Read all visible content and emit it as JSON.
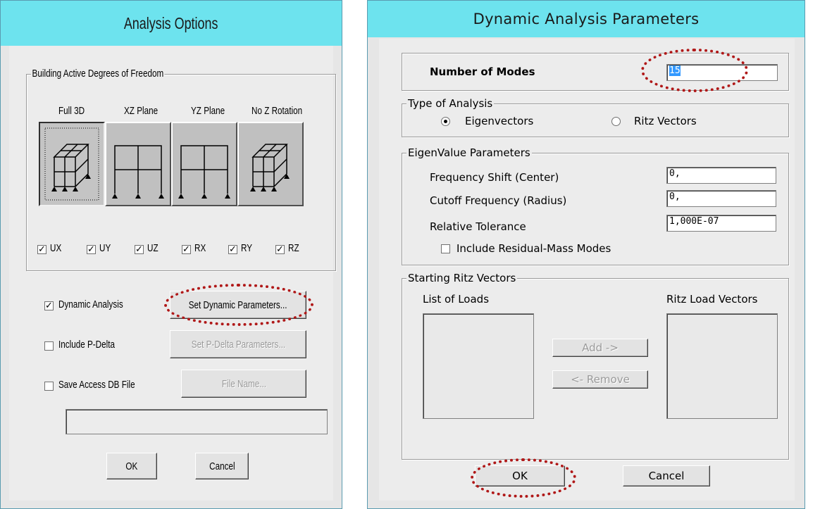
{
  "analysis_options": {
    "title": "Analysis Options",
    "dof_group_label": "Building Active Degrees of Freedom",
    "dof_options": [
      {
        "label": "Full 3D",
        "selected": true
      },
      {
        "label": "XZ Plane",
        "selected": false
      },
      {
        "label": "YZ Plane",
        "selected": false
      },
      {
        "label": "No Z Rotation",
        "selected": false
      }
    ],
    "dof_checkboxes": [
      {
        "label": "UX",
        "checked": true
      },
      {
        "label": "UY",
        "checked": true
      },
      {
        "label": "UZ",
        "checked": true
      },
      {
        "label": "RX",
        "checked": true
      },
      {
        "label": "RY",
        "checked": true
      },
      {
        "label": "RZ",
        "checked": true
      }
    ],
    "dynamic_analysis": {
      "label": "Dynamic Analysis",
      "checked": true,
      "button": "Set Dynamic Parameters..."
    },
    "p_delta": {
      "label": "Include P-Delta",
      "checked": false,
      "button": "Set P-Delta Parameters..."
    },
    "access_db": {
      "label": "Save Access DB File",
      "checked": false,
      "button": "File Name..."
    },
    "file_name_value": "",
    "ok_label": "OK",
    "cancel_label": "Cancel"
  },
  "dynamic_params": {
    "title": "Dynamic Analysis Parameters",
    "modes_label": "Number of Modes",
    "modes_value": "15",
    "type_group_label": "Type of Analysis",
    "type_options": [
      {
        "label": "Eigenvectors",
        "selected": true
      },
      {
        "label": "Ritz Vectors",
        "selected": false
      }
    ],
    "eigen_group_label": "EigenValue Parameters",
    "eigen_fields": [
      {
        "label": "Frequency Shift  (Center)",
        "value": "0,"
      },
      {
        "label": "Cutoff Frequency  (Radius)",
        "value": "0,"
      },
      {
        "label": "Relative Tolerance",
        "value": "1,000E-07"
      }
    ],
    "residual_mass": {
      "label": "Include Residual-Mass Modes",
      "checked": false
    },
    "ritz_group_label": "Starting Ritz Vectors",
    "list_of_loads_label": "List of Loads",
    "ritz_load_vectors_label": "Ritz Load Vectors",
    "add_label": "Add ->",
    "remove_label": "<- Remove",
    "ok_label": "OK",
    "cancel_label": "Cancel"
  },
  "colors": {
    "title_bar": "#6de3ee",
    "highlight_ellipse": "#b01818",
    "selection": "#3399ff"
  }
}
